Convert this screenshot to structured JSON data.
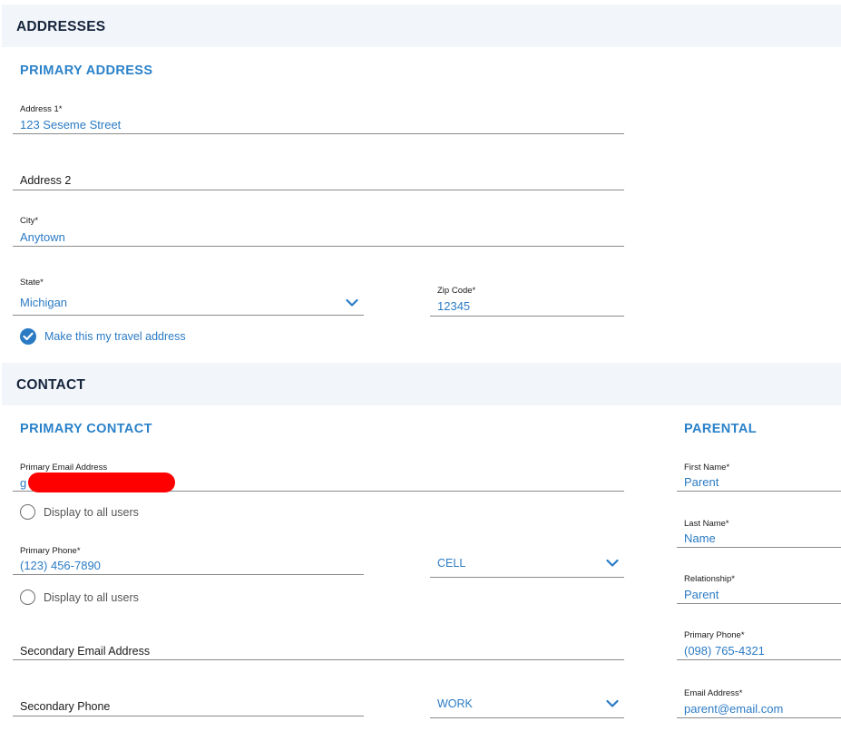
{
  "addresses": {
    "section_title": "ADDRESSES",
    "primary_title": "PRIMARY ADDRESS",
    "address1": {
      "label": "Address 1*",
      "value": "123 Seseme Street"
    },
    "address2": {
      "placeholder": "Address 2"
    },
    "city": {
      "label": "City*",
      "value": "Anytown"
    },
    "state": {
      "label": "State*",
      "value": "Michigan",
      "icon": "chevron-down-icon"
    },
    "zip": {
      "label": "Zip Code*",
      "value": "12345"
    },
    "travel_checkbox": {
      "label": "Make this my travel address",
      "checked": true
    }
  },
  "contact": {
    "section_title": "CONTACT",
    "primary_title": "PRIMARY CONTACT",
    "email": {
      "label": "Primary Email Address",
      "value": "g"
    },
    "email_display": {
      "label": "Display to all users"
    },
    "phone": {
      "label": "Primary Phone*",
      "value": "(123) 456-7890"
    },
    "phone_type": {
      "value": "CELL",
      "icon": "chevron-down-icon"
    },
    "phone_display": {
      "label": "Display to all users"
    },
    "secondary_email": {
      "placeholder": "Secondary Email Address"
    },
    "secondary_phone": {
      "placeholder": "Secondary Phone"
    },
    "secondary_phone_type": {
      "value": "WORK",
      "icon": "chevron-down-icon"
    }
  },
  "parental": {
    "title": "PARENTAL",
    "first_name": {
      "label": "First Name*",
      "value": "Parent"
    },
    "last_name": {
      "label": "Last Name*",
      "value": "Name"
    },
    "relationship": {
      "label": "Relationship*",
      "value": "Parent"
    },
    "phone": {
      "label": "Primary Phone*",
      "value": "(098) 765-4321"
    },
    "email": {
      "label": "Email Address*",
      "value": "parent@email.com"
    }
  },
  "colors": {
    "accent": "#2b7bc4",
    "heading": "#17253d",
    "section_bg": "#f2f6fa",
    "redaction": "#ff0000"
  }
}
